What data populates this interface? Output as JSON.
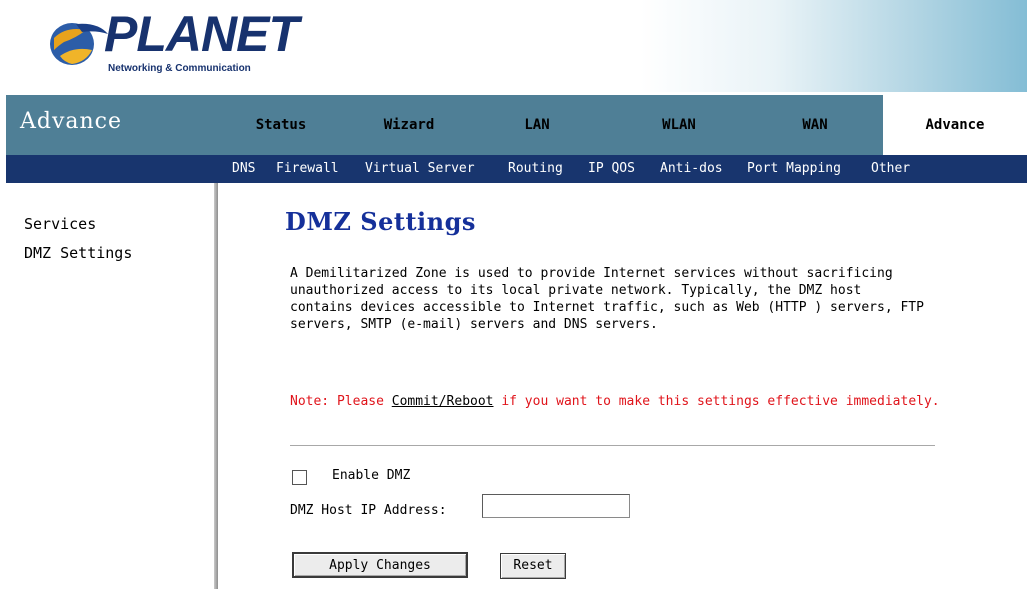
{
  "header": {
    "brand_name": "PLANET",
    "brand_tagline": "Networking & Communication"
  },
  "nav": {
    "section_title": "Advance",
    "tabs": [
      {
        "label": "Status"
      },
      {
        "label": "Wizard"
      },
      {
        "label": "LAN"
      },
      {
        "label": "WLAN"
      },
      {
        "label": "WAN"
      },
      {
        "label": "Advance"
      }
    ],
    "active_tab": "Advance"
  },
  "subnav": {
    "items": [
      {
        "label": "DNS"
      },
      {
        "label": "Firewall"
      },
      {
        "label": "Virtual Server"
      },
      {
        "label": "Routing"
      },
      {
        "label": "IP QOS"
      },
      {
        "label": "Anti-dos"
      },
      {
        "label": "Port Mapping"
      },
      {
        "label": "Other"
      }
    ]
  },
  "sidebar": {
    "items": [
      {
        "label": "Services"
      },
      {
        "label": "DMZ Settings"
      }
    ]
  },
  "main": {
    "title": "DMZ Settings",
    "description": "A Demilitarized Zone is used to provide Internet services without sacrificing unauthorized access to its local private network. Typically, the DMZ host contains devices accessible to Internet traffic, such as Web (HTTP ) servers, FTP servers, SMTP (e-mail) servers and DNS servers.",
    "note_prefix": "Note: Please ",
    "note_link": "Commit/Reboot",
    "note_suffix": " if you want to make this settings effective immediately.",
    "enable_dmz_label": "Enable DMZ",
    "enable_dmz_checked": false,
    "dmz_host_ip_label": "DMZ Host IP Address:",
    "dmz_host_ip_value": "",
    "apply_button": "Apply Changes",
    "reset_button": "Reset"
  },
  "colors": {
    "nav_bg": "#4f7f96",
    "subnav_bg": "#18356e",
    "title_blue": "#15309a",
    "note_red": "#e0141b",
    "brand_blue": "#17326e"
  }
}
